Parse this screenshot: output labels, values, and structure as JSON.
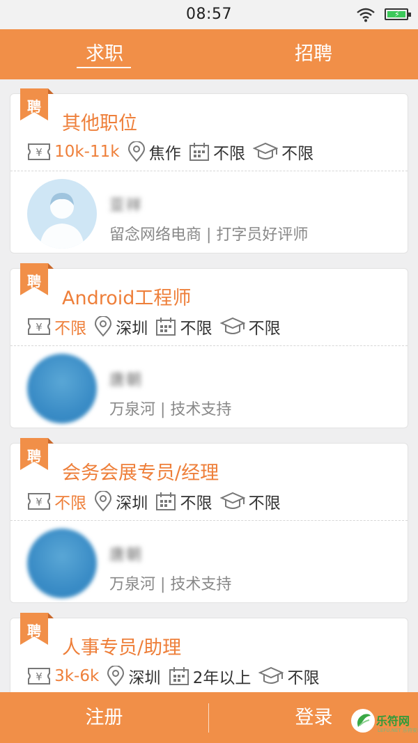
{
  "status_bar": {
    "time": "08:57"
  },
  "tabs": [
    {
      "label": "求职"
    },
    {
      "label": "招聘"
    }
  ],
  "jobs": [
    {
      "badge": "聘",
      "title": "其他职位",
      "salary": "10k-11k",
      "location": "焦作",
      "experience": "不限",
      "education": "不限",
      "poster_name": "亚祥",
      "poster_company": "留念网络电商 | 打字员好评师"
    },
    {
      "badge": "聘",
      "title": "Android工程师",
      "salary": "不限",
      "location": "深圳",
      "experience": "不限",
      "education": "不限",
      "poster_name": "唐朝",
      "poster_company": "万泉河 | 技术支持"
    },
    {
      "badge": "聘",
      "title": "会务会展专员/经理",
      "salary": "不限",
      "location": "深圳",
      "experience": "不限",
      "education": "不限",
      "poster_name": "唐朝",
      "poster_company": "万泉河 | 技术支持"
    },
    {
      "badge": "聘",
      "title": "人事专员/助理",
      "salary": "3k-6k",
      "location": "深圳",
      "experience": "2年以上",
      "education": "不限"
    }
  ],
  "bottom": {
    "register": "注册",
    "login": "登录"
  },
  "watermark": {
    "text": "乐符网",
    "sub": "LEFU.NET 乐符安装"
  },
  "colors": {
    "accent": "#f18f48",
    "title": "#ee7f3a"
  }
}
